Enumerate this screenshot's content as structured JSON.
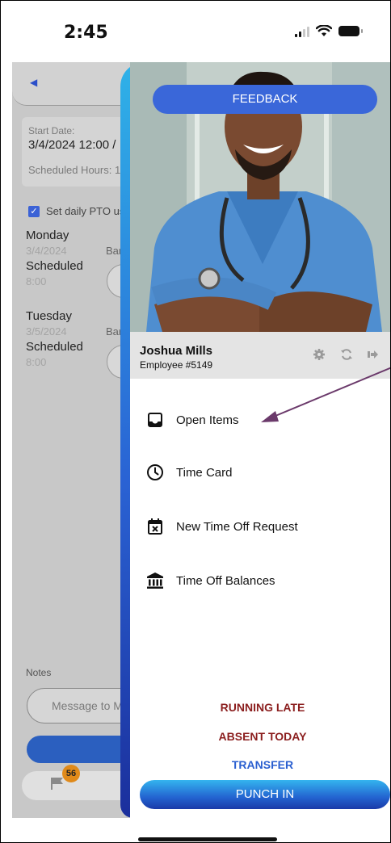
{
  "status_bar": {
    "time": "2:45"
  },
  "background_screen": {
    "start_date_label": "Start Date:",
    "start_date_value": "3/4/2024 12:00 /",
    "scheduled_hours_label": "Scheduled Hours: 1",
    "pto_checkbox_label": "Set daily PTO us",
    "days": [
      {
        "name": "Monday",
        "date": "3/4/2024",
        "ban": "Bar",
        "scheduled_label": "Scheduled",
        "hours": "8:00"
      },
      {
        "name": "Tuesday",
        "date": "3/5/2024",
        "ban": "Bar",
        "scheduled_label": "Scheduled",
        "hours": "8:00"
      }
    ],
    "notes_label": "Notes",
    "message_placeholder": "Message to Ma",
    "badge_count": "56"
  },
  "drawer": {
    "feedback_label": "FEEDBACK",
    "profile": {
      "name": "Joshua Mills",
      "employee": "Employee #5149"
    },
    "menu": [
      {
        "label": "Open Items",
        "icon": "inbox-icon"
      },
      {
        "label": "Time Card",
        "icon": "clock-icon"
      },
      {
        "label": "New Time Off Request",
        "icon": "calendar-x-icon"
      },
      {
        "label": "Time Off Balances",
        "icon": "bank-icon"
      }
    ],
    "actions": {
      "running_late": "RUNNING LATE",
      "absent_today": "ABSENT TODAY",
      "transfer": "TRANSFER",
      "punch_in": "PUNCH IN"
    }
  },
  "colors": {
    "accent_blue": "#3a67d9",
    "late_red": "#8b1e1e",
    "transfer_blue": "#2a5fd0",
    "annotation_arrow": "#6b3a6b"
  }
}
